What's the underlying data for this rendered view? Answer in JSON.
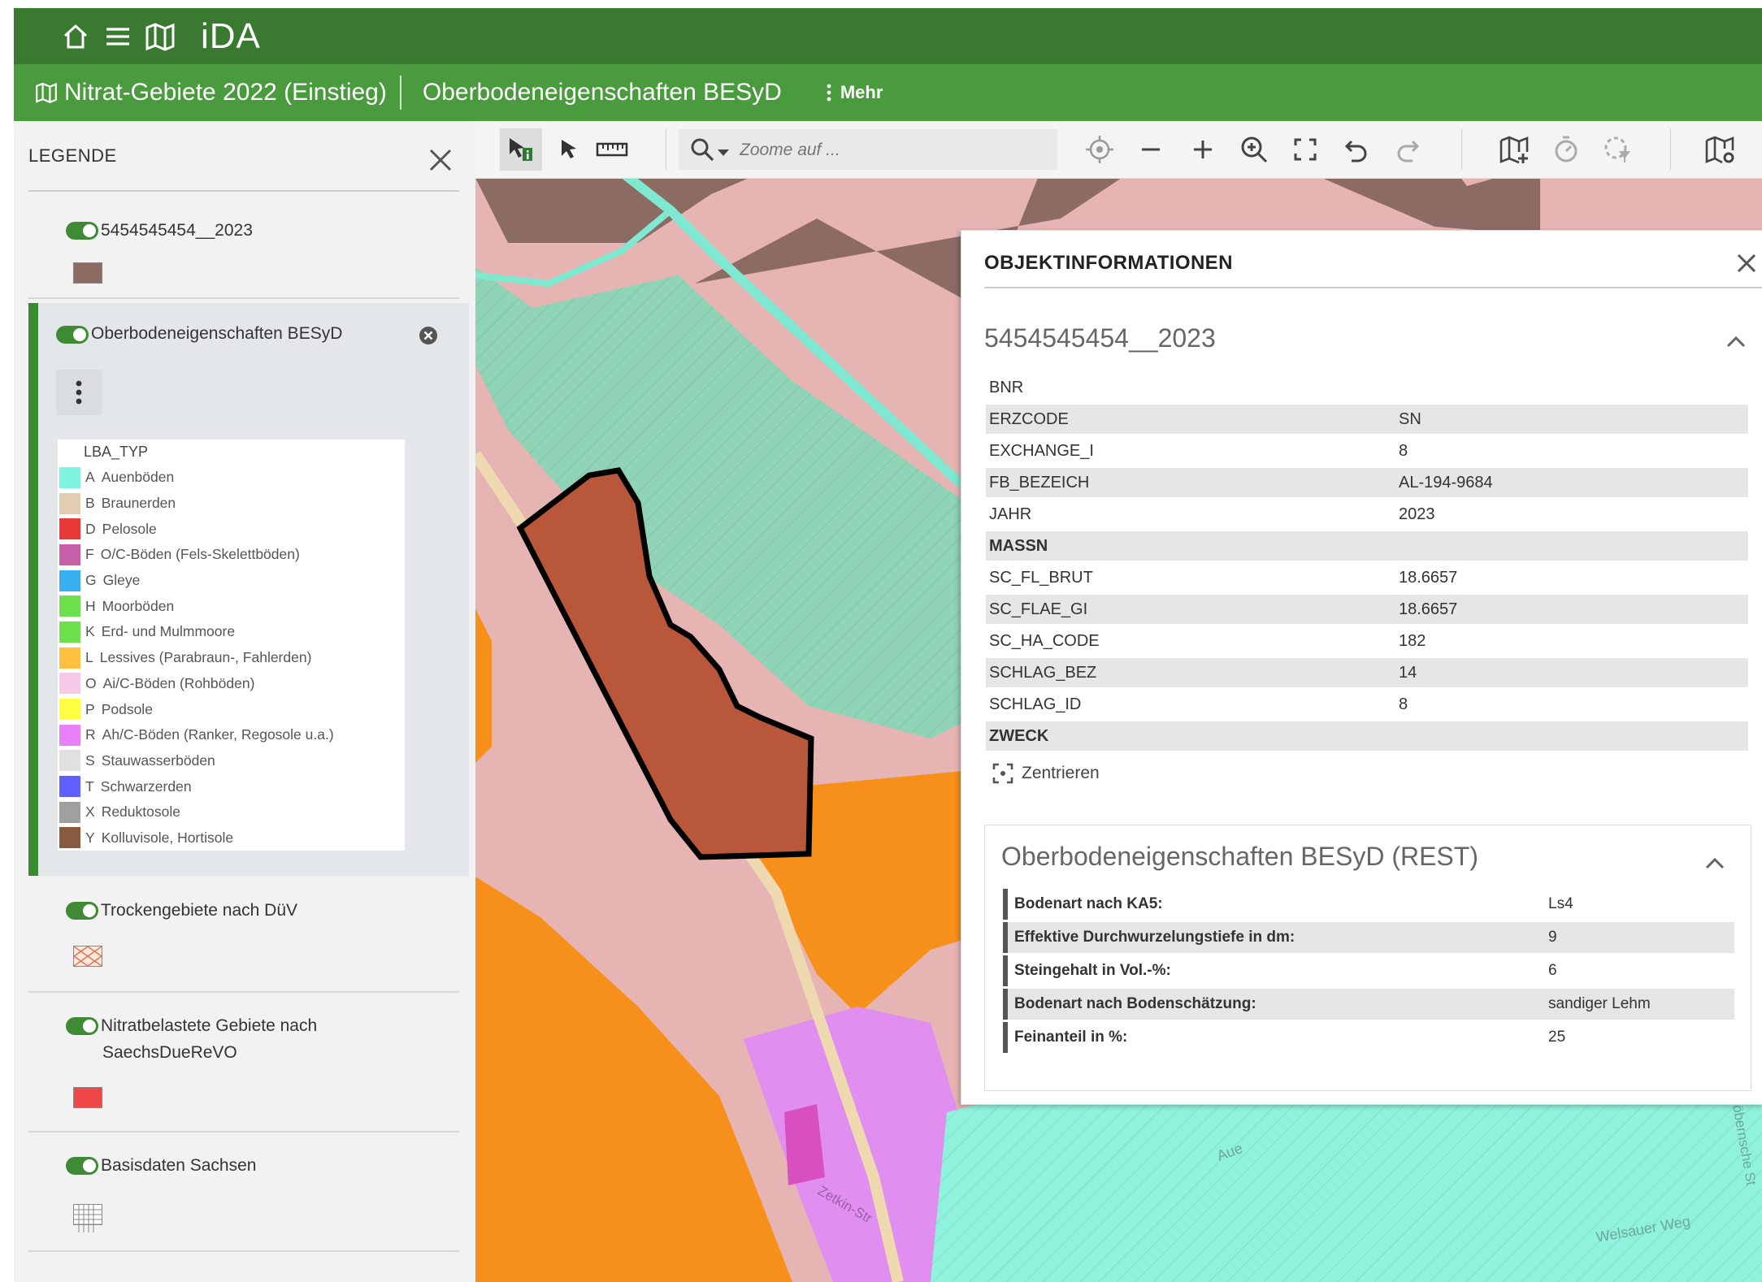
{
  "app": {
    "title": "iDA"
  },
  "breadcrumb": {
    "project": "Nitrat-Gebiete 2022 (Einstieg)",
    "layer": "Oberbodeneigenschaften BESyD",
    "more": "Mehr"
  },
  "legend": {
    "header": "LEGENDE",
    "layers": [
      {
        "name": "5454545454__2023",
        "swatch_color": "#8b6b62"
      },
      {
        "name": "Oberbodeneigenschaften BESyD"
      },
      {
        "name": "Trockengebiete nach DüV"
      },
      {
        "name_line1": "Nitratbelastete Gebiete nach",
        "name_line2": "SaechsDueReVO",
        "swatch_color": "#f04848"
      },
      {
        "name": "Basisdaten Sachsen"
      }
    ],
    "lba_header": "LBA_TYP",
    "lba_items": [
      {
        "code": "A",
        "label": "Auenböden",
        "color": "#7ff5e0"
      },
      {
        "code": "B",
        "label": "Braunerden",
        "color": "#e2cdb0"
      },
      {
        "code": "D",
        "label": "Pelosole",
        "color": "#e83838"
      },
      {
        "code": "F",
        "label": "O/C-Böden (Fels-Skelettböden)",
        "color": "#c75ea8"
      },
      {
        "code": "G",
        "label": "Gleye",
        "color": "#38b0f0"
      },
      {
        "code": "H",
        "label": "Moorböden",
        "color": "#6ee04e"
      },
      {
        "code": "K",
        "label": "Erd- und Mulmmoore",
        "color": "#6ee04e"
      },
      {
        "code": "L",
        "label": "Lessives (Parabraun-, Fahlerden)",
        "color": "#ffc040"
      },
      {
        "code": "O",
        "label": "Ai/C-Böden (Rohböden)",
        "color": "#f8c8e8"
      },
      {
        "code": "P",
        "label": "Podsole",
        "color": "#ffff40"
      },
      {
        "code": "R",
        "label": "Ah/C-Böden (Ranker, Regosole u.a.)",
        "color": "#e880f8"
      },
      {
        "code": "S",
        "label": "Stauwasserböden",
        "color": "#e0e0e0"
      },
      {
        "code": "T",
        "label": "Schwarzerden",
        "color": "#6060ff"
      },
      {
        "code": "X",
        "label": "Reduktosole",
        "color": "#a0a0a0"
      },
      {
        "code": "Y",
        "label": "Kolluvisole, Hortisole",
        "color": "#8a5a40"
      }
    ]
  },
  "toolbar": {
    "search_placeholder": "Zoome auf ..."
  },
  "info": {
    "title": "OBJEKTINFORMATIONEN",
    "feature_title": "5454545454__2023",
    "attributes": [
      {
        "key": "BNR",
        "value": ""
      },
      {
        "key": "ERZCODE",
        "value": "SN"
      },
      {
        "key": "EXCHANGE_I",
        "value": "8"
      },
      {
        "key": "FB_BEZEICH",
        "value": "AL-194-9684"
      },
      {
        "key": "JAHR",
        "value": "2023"
      },
      {
        "key": "MASSN",
        "value": ""
      },
      {
        "key": "SC_FL_BRUT",
        "value": "18.6657"
      },
      {
        "key": "SC_FLAE_GI",
        "value": "18.6657"
      },
      {
        "key": "SC_HA_CODE",
        "value": "182"
      },
      {
        "key": "SCHLAG_BEZ",
        "value": "14"
      },
      {
        "key": "SCHLAG_ID",
        "value": "8"
      },
      {
        "key": "ZWECK",
        "value": ""
      }
    ],
    "center_label": "Zentrieren",
    "rest_title": "Oberbodeneigenschaften BESyD (REST)",
    "rest_attributes": [
      {
        "key": "Bodenart nach KA5:",
        "value": "Ls4"
      },
      {
        "key": "Effektive Durchwurzelungstiefe in dm:",
        "value": "9"
      },
      {
        "key": "Steingehalt in Vol.-%:",
        "value": "6"
      },
      {
        "key": "Bodenart nach Bodenschätzung:",
        "value": "sandiger Lehm"
      },
      {
        "key": "Feinanteil in %:",
        "value": "25"
      }
    ]
  },
  "map_labels": {
    "road1": "Aue",
    "road2": "Welsauer Weg",
    "road3": "Döbernsche St",
    "road4": "Zetkin-Str"
  },
  "colors": {
    "topbar": "#3a7a30",
    "subbar": "#4a9a3e",
    "toggle": "#3f8a35",
    "parcel": "#b9573a"
  }
}
